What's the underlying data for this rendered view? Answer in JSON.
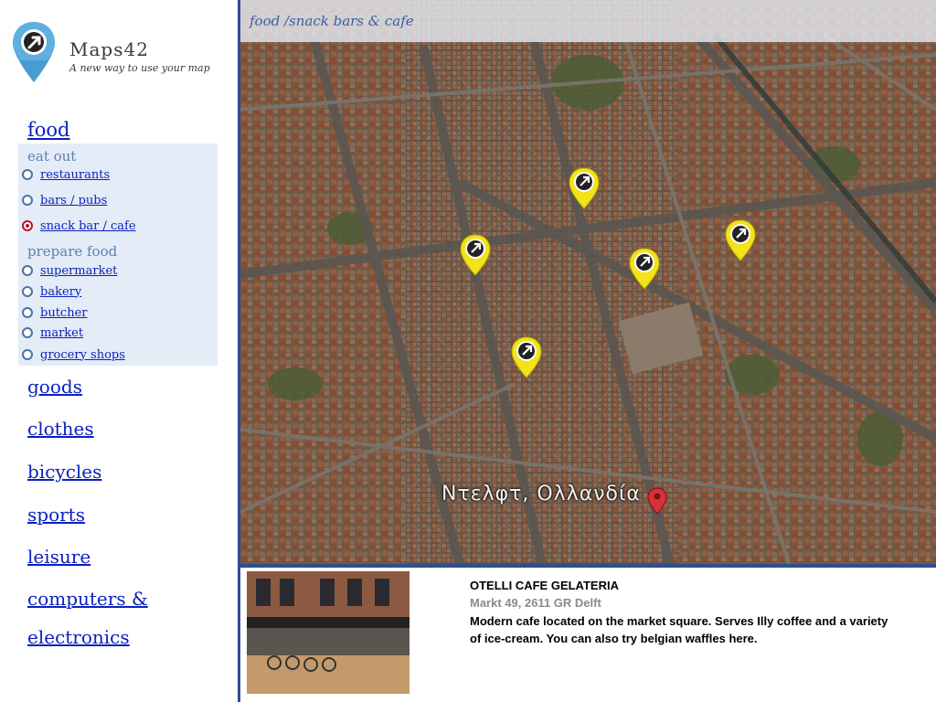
{
  "app": {
    "name": "Maps42",
    "tagline": "A new way to use your map"
  },
  "sidebar": {
    "active_category": "food",
    "groups": [
      {
        "heading": "eat out",
        "items": [
          {
            "label": "restaurants",
            "selected": false
          },
          {
            "label": "bars / pubs",
            "selected": false
          },
          {
            "label": "snack bar / cafe",
            "selected": true
          }
        ]
      },
      {
        "heading": "prepare food",
        "items": [
          {
            "label": "supermarket",
            "selected": false
          },
          {
            "label": "bakery",
            "selected": false
          },
          {
            "label": "butcher",
            "selected": false
          },
          {
            "label": "market",
            "selected": false
          },
          {
            "label": "grocery shops",
            "selected": false
          }
        ]
      }
    ],
    "categories": [
      "goods",
      "clothes",
      "bicycles",
      "sports",
      "leisure",
      "computers &",
      "electronics"
    ]
  },
  "map": {
    "title": "food /snack bars & cafe",
    "place_label": "Ντελφτ, Ολλανδία",
    "pin_count": 5
  },
  "info": {
    "name": "OTELLI CAFE GELATERIA",
    "address": "Markt 49, 2611 GR Delft",
    "description": " Modern cafe located on the market square. Serves Illy coffee and a variety of ice-cream. You can also try belgian waffles here."
  },
  "colors": {
    "link": "#0b1fbf",
    "accent_border": "#2f4f8c",
    "subpanel": "#e4ecf7",
    "pin_yellow": "#f4e21a",
    "selected_radio": "#c0102a"
  }
}
